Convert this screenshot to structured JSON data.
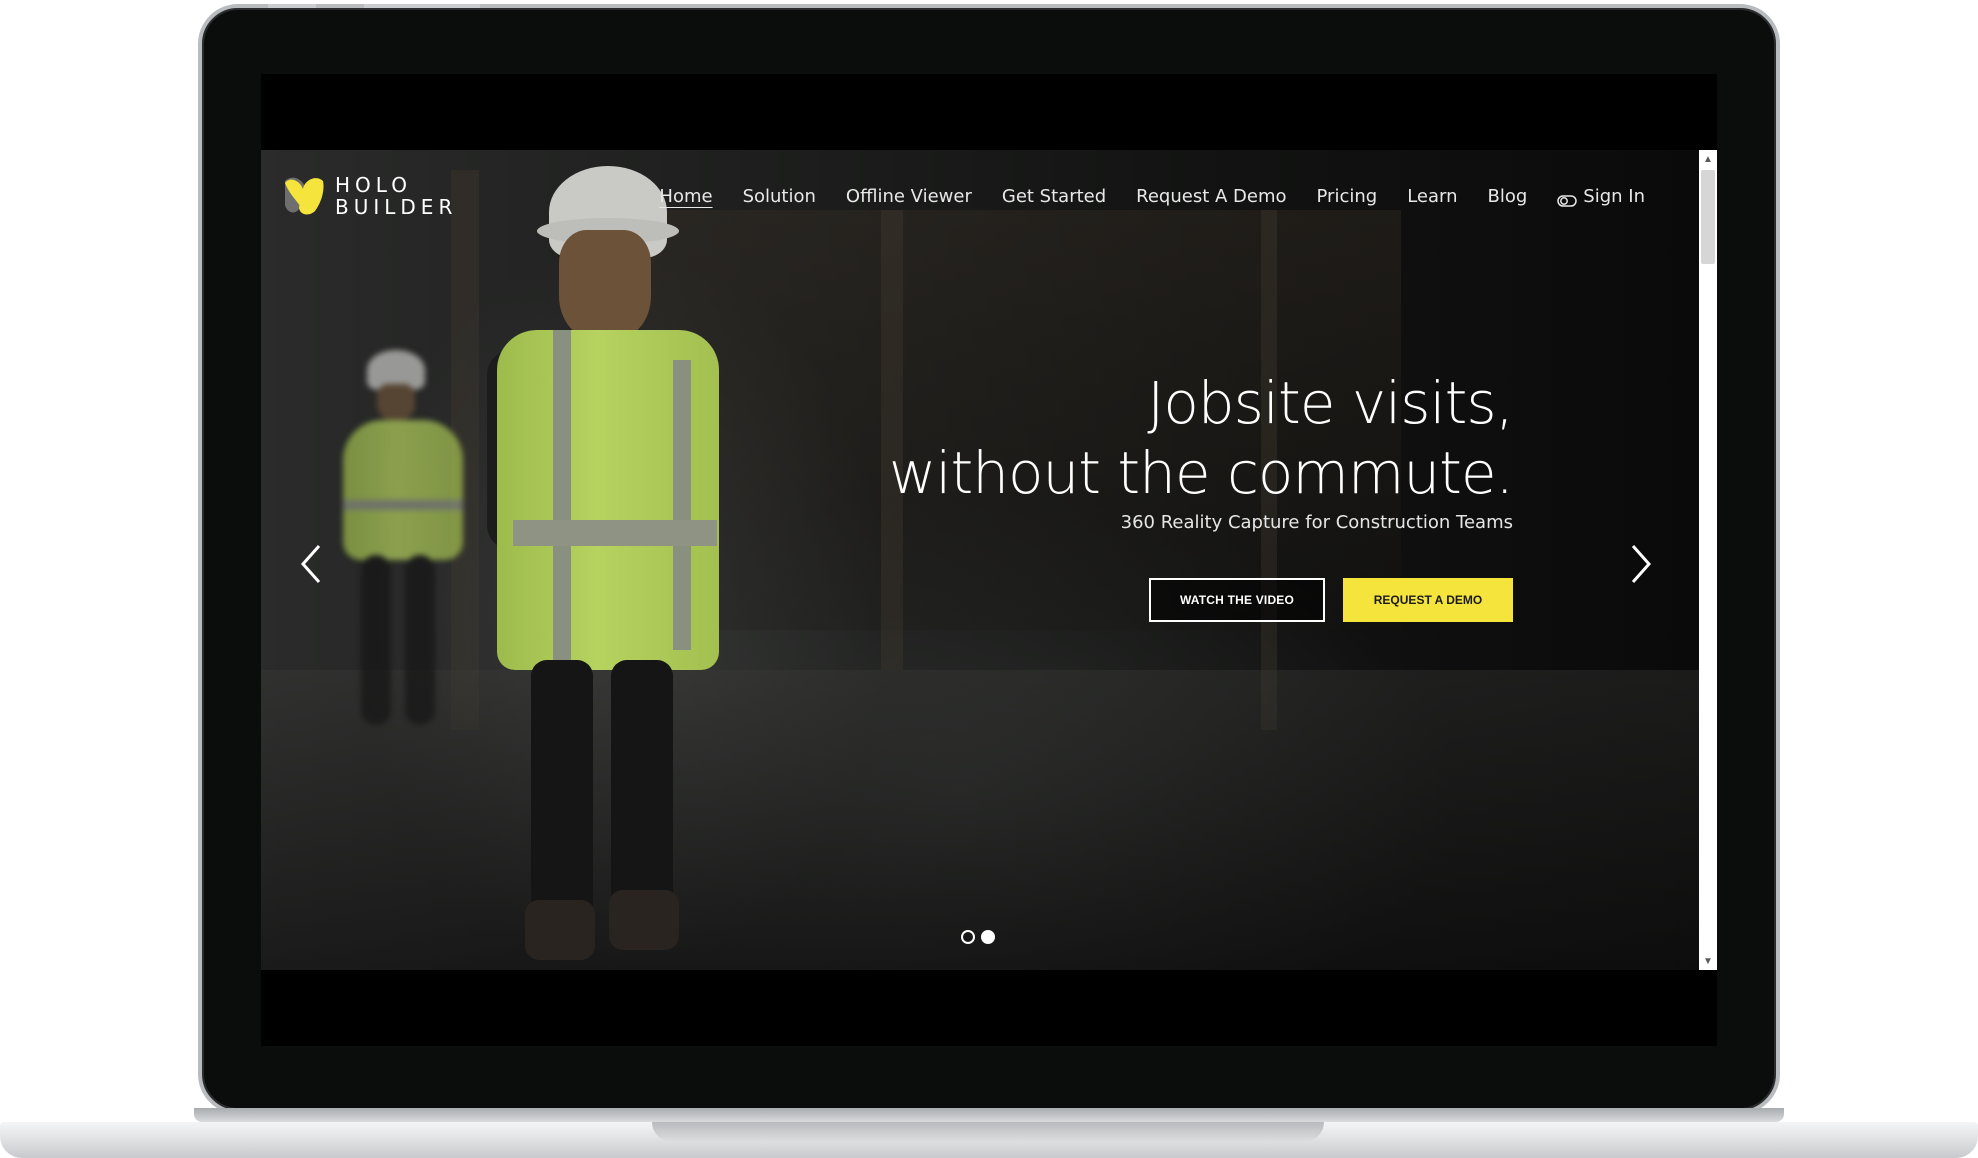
{
  "logo": {
    "line1": "HOLO",
    "line2": "BUILDER",
    "icon": "holobuilder-logo-icon",
    "colors": {
      "yellow": "#f4e43b",
      "gray": "#6e6e6e"
    }
  },
  "nav": {
    "items": [
      {
        "label": "Home",
        "active": true
      },
      {
        "label": "Solution"
      },
      {
        "label": "Offline Viewer"
      },
      {
        "label": "Get Started"
      },
      {
        "label": "Request A Demo"
      },
      {
        "label": "Pricing"
      },
      {
        "label": "Learn"
      },
      {
        "label": "Blog"
      }
    ],
    "sign_in": {
      "label": "Sign In",
      "icon": "toggle-icon"
    }
  },
  "hero": {
    "headline_line1": "Jobsite visits,",
    "headline_line2": "without the commute.",
    "subheadline": "360 Reality Capture for Construction Teams",
    "buttons": {
      "watch_video": "WATCH THE VIDEO",
      "request_demo": "REQUEST A DEMO"
    },
    "carousel": {
      "prev_icon": "chevron-left-icon",
      "next_icon": "chevron-right-icon",
      "slide_count": 2,
      "active_slide": 2
    }
  },
  "colors": {
    "accent": "#f4e43b",
    "text": "#ffffff"
  }
}
